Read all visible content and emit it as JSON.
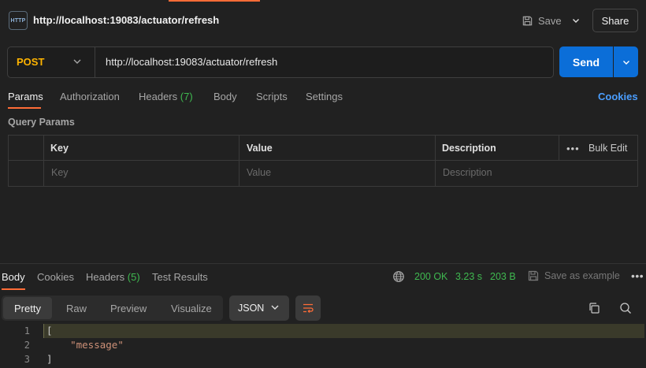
{
  "header": {
    "icon_label": "HTTP",
    "title": "http://localhost:19083/actuator/refresh",
    "save_label": "Save",
    "share_label": "Share"
  },
  "request": {
    "method": "POST",
    "url": "http://localhost:19083/actuator/refresh",
    "send_label": "Send",
    "method_color": "#ffb400",
    "send_color": "#0b6ed8"
  },
  "request_tabs": {
    "params": "Params",
    "authorization": "Authorization",
    "headers": "Headers",
    "headers_count": "(7)",
    "body": "Body",
    "scripts": "Scripts",
    "settings": "Settings",
    "cookies": "Cookies"
  },
  "query_params": {
    "section_label": "Query Params",
    "columns": [
      "Key",
      "Value",
      "Description"
    ],
    "bulk_edit": "Bulk Edit",
    "placeholders": [
      "Key",
      "Value",
      "Description"
    ]
  },
  "response_tabs": {
    "body": "Body",
    "cookies": "Cookies",
    "headers": "Headers",
    "headers_count": "(5)",
    "test_results": "Test Results"
  },
  "response_status": {
    "status": "200 OK",
    "time": "3.23 s",
    "size": "203 B",
    "save_as_example": "Save as example",
    "status_color": "#3fb950"
  },
  "response_view": {
    "pretty": "Pretty",
    "raw": "Raw",
    "preview": "Preview",
    "visualize": "Visualize",
    "format": "JSON"
  },
  "code": {
    "line_numbers": [
      "1",
      "2",
      "3"
    ],
    "line1": "[",
    "line2_indent": "    ",
    "line2_string": "\"message\"",
    "line3": "]"
  },
  "accent_color": "#ff6c37"
}
